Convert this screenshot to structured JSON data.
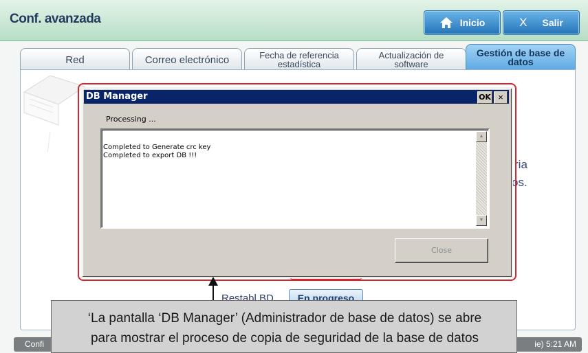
{
  "header": {
    "title": "Conf. avanzada",
    "home_label": "Inicio",
    "exit_label": "Salir",
    "exit_glyph": "X"
  },
  "tabs": [
    {
      "label": "Red"
    },
    {
      "label": "Correo electrónico"
    },
    {
      "label": "Fecha de referencia estadística"
    },
    {
      "label": "Actualización de software"
    },
    {
      "label": "Gestión de base de datos",
      "active": true
    }
  ],
  "background": {
    "fragment_1": "ria",
    "fragment_2": "os.",
    "restore_label": "Restabl.BD",
    "progress_label": "En progreso"
  },
  "dialog": {
    "title": "DB Manager",
    "ok_label": "OK",
    "close_glyph": "×",
    "processing": "Processing ...",
    "log_lines": [
      "Completed to Generate crc key",
      "Completed to export DB !!!"
    ],
    "close_button": "Close"
  },
  "status_bar": {
    "left": "Confi",
    "right": "ie) 5:21 AM"
  },
  "callout": {
    "line1": "‘La pantalla ‘DB Manager’ (Administrador de base de datos) se abre",
    "line2": "para mostrar el proceso de copia de seguridad de la base de datos"
  },
  "colors": {
    "header_bg": "#c7e6d2",
    "accent_blue": "#2574b8",
    "dialog_title_bg": "#0a246a",
    "highlight_red": "#d9232d"
  },
  "icons": {
    "home": "home-icon",
    "close": "close-icon",
    "scroll_up": "scroll-up-arrow-icon",
    "scroll_down": "scroll-down-arrow-icon",
    "callout_arrow": "arrow-up-icon"
  }
}
